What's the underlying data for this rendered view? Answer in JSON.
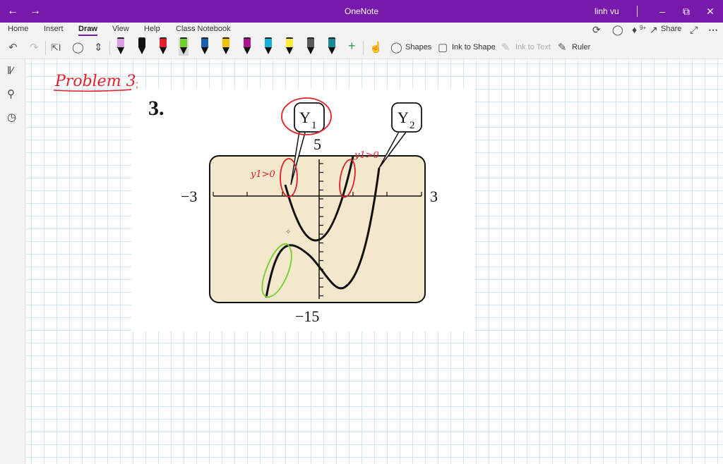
{
  "window": {
    "title": "OneNote",
    "user": "linh vu"
  },
  "ribbon": {
    "tabs": [
      "Home",
      "Insert",
      "Draw",
      "View",
      "Help",
      "Class Notebook"
    ],
    "active_tab": "Draw",
    "share_label": "Share",
    "notification_badge": "9+"
  },
  "toolbar": {
    "pens": [
      {
        "color": "#d9a0e0",
        "selected": false
      },
      {
        "color": "#111111",
        "selected": false
      },
      {
        "color": "#e0202a",
        "selected": false
      },
      {
        "color": "#6fcf2c",
        "selected": true
      },
      {
        "color": "#1a5fb4",
        "selected": false
      },
      {
        "color": "#f2c300",
        "selected": false
      },
      {
        "color": "#b0128a",
        "selected": false
      },
      {
        "color": "#1ab0d8",
        "selected": false
      },
      {
        "color": "#ffe93b",
        "selected": false
      },
      {
        "color": "#5a5a5a",
        "selected": false
      },
      {
        "color": "#1a8a9a",
        "selected": false
      }
    ],
    "shapes_label": "Shapes",
    "ink_to_shape_label": "Ink to Shape",
    "ink_to_text_label": "Ink to Text",
    "ruler_label": "Ruler"
  },
  "page": {
    "handwritten_title": "Problem 3",
    "problem_number": "3.",
    "graph": {
      "labels": {
        "y1": "Y",
        "y1_sub": "1",
        "y2": "Y",
        "y2_sub": "2",
        "ymax": "5",
        "ymin": "−15",
        "xmin": "−3",
        "xmax": "3"
      },
      "annotation_left": "y1>0",
      "annotation_right": "y1>0"
    }
  },
  "colors": {
    "accent": "#7719aa",
    "graph_bg": "#f3e7cc",
    "ink_red": "#e0202a",
    "ink_green": "#6fcf2c"
  }
}
